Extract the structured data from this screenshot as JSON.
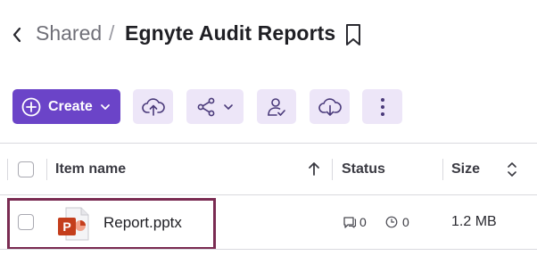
{
  "header": {
    "back_icon": "chevron-left-icon",
    "breadcrumb_parent": "Shared",
    "breadcrumb_separator": "/",
    "folder_title": "Egnyte Audit Reports",
    "bookmark_icon": "bookmark-icon"
  },
  "toolbar": {
    "create_label": "Create",
    "create_icon": "plus-circle-icon",
    "create_chevron_icon": "chevron-down-icon",
    "upload_icon": "cloud-upload-icon",
    "share_icon": "share-icon",
    "share_chevron_icon": "chevron-down-icon",
    "user_icon": "user-check-icon",
    "download_icon": "cloud-download-icon",
    "more_icon": "more-vertical-icon"
  },
  "table": {
    "columns": {
      "name": "Item name",
      "status": "Status",
      "size": "Size"
    },
    "sort_icon": "arrow-up-icon",
    "size_sort_icon": "sort-updown-icon",
    "rows": [
      {
        "name": "Report.pptx",
        "file_icon": "powerpoint-file-icon",
        "comments": "0",
        "tasks": "0",
        "size": "1.2 MB"
      }
    ]
  },
  "colors": {
    "accent": "#6b44c8",
    "toolbar_button_bg": "#ede6f8",
    "highlight_border": "#7a2b52",
    "powerpoint": "#c43e1c"
  }
}
